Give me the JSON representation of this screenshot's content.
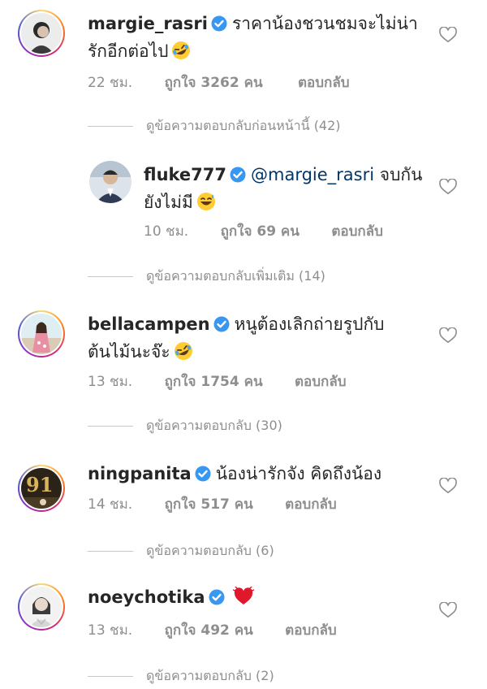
{
  "comments": [
    {
      "username": "margie_rasri",
      "text_line1": "ราคาน้องชวนชมจะไม่น่า",
      "text_line2": "รักอีกต่อไป",
      "emoji": "rolling-laughing-emoji",
      "time": "22 ชม.",
      "likes": "ถูกใจ 3262 คน",
      "reply": "ตอบกลับ",
      "thread": "ดูข้อความตอบกลับก่อนหน้านี้ (42)"
    },
    {
      "username": "fluke777",
      "mention": "@margie_rasri",
      "text_line1": "จบกัน",
      "text_line2": "ยังไม่มี",
      "emoji": "sweat-smile-emoji",
      "time": "10 ชม.",
      "likes": "ถูกใจ 69 คน",
      "reply": "ตอบกลับ",
      "thread": "ดูข้อความตอบกลับเพิ่มเติม (14)"
    },
    {
      "username": "bellacampen",
      "text_line1": "หนูต้องเลิกถ่ายรูปกับ",
      "text_line2": "ต้นไม้นะจ๊ะ",
      "emoji": "rolling-laughing-emoji",
      "time": "13 ชม.",
      "likes": "ถูกใจ 1754 คน",
      "reply": "ตอบกลับ",
      "thread": "ดูข้อความตอบกลับ (30)"
    },
    {
      "username": "ningpanita",
      "text_line1": "น้องน่ารักจัง คิดถึงน้อง",
      "avatar_text": "91",
      "time": "14 ชม.",
      "likes": "ถูกใจ 517 คน",
      "reply": "ตอบกลับ",
      "thread": "ดูข้อความตอบกลับ (6)"
    },
    {
      "username": "noeychotika",
      "emoji": "red-heart-emoji",
      "time": "13 ชม.",
      "likes": "ถูกใจ 492 คน",
      "reply": "ตอบกลับ",
      "thread": "ดูข้อความตอบกลับ (2)"
    }
  ],
  "colors": {
    "text": "#262626",
    "muted": "#8e8e8e",
    "verified": "#3897f0",
    "mention": "#00376b"
  }
}
